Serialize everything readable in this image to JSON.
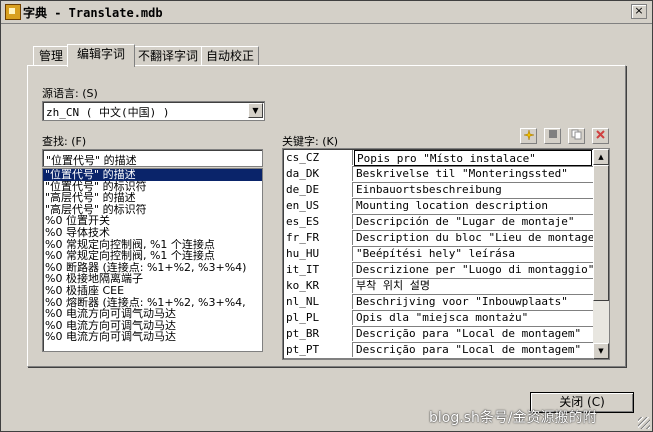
{
  "window": {
    "title": "字典 - Translate.mdb",
    "close_glyph": "×"
  },
  "tabs": [
    {
      "label": "管理"
    },
    {
      "label": "编辑字词"
    },
    {
      "label": "不翻译字词"
    },
    {
      "label": "自动校正"
    }
  ],
  "source_language": {
    "label": "源语言: (S)",
    "value": "zh_CN ( 中文(中国) )"
  },
  "search": {
    "label": "查找: (F)",
    "value": "\"位置代号\" 的描述"
  },
  "word_list": [
    "\"位置代号\" 的描述",
    "\"位置代号\" 的标识符",
    "\"高层代号\" 的描述",
    "\"高层代号\" 的标识符",
    "%0 位置开关",
    "%0 导体技术",
    "%0 常规定向控制阀, %1 个连接点",
    "%0 常规定向控制阀, %1 个连接点",
    "%0 断路器 (连接点: %1+%2, %3+%4)",
    "%0 极接地隔离端子",
    "%0 极插座 CEE",
    "%0 熔断器 (连接点: %1+%2, %3+%4,",
    "%0 电流方向可调气动马达",
    "%0 电流方向可调气动马达",
    "%0 电流方向可调气动马达"
  ],
  "keywords": {
    "label": "关键字: (K)",
    "toolbar_icons": [
      "new-entry-icon",
      "stop-icon",
      "copy-icon",
      "delete-icon"
    ],
    "rows": [
      {
        "code": "cs_CZ",
        "text": "Popis pro \"Místo instalace\""
      },
      {
        "code": "da_DK",
        "text": "Beskrivelse til \"Monteringssted\""
      },
      {
        "code": "de_DE",
        "text": "Einbauortsbeschreibung"
      },
      {
        "code": "en_US",
        "text": "Mounting location description"
      },
      {
        "code": "es_ES",
        "text": "Descripción de \"Lugar de montaje\""
      },
      {
        "code": "fr_FR",
        "text": "Description du bloc \"Lieu de montage\""
      },
      {
        "code": "hu_HU",
        "text": "\"Beépítési hely\" leírása"
      },
      {
        "code": "it_IT",
        "text": "Descrizione per \"Luogo di montaggio\""
      },
      {
        "code": "ko_KR",
        "text": "부착 위치 설명"
      },
      {
        "code": "nl_NL",
        "text": "Beschrijving voor \"Inbouwplaats\""
      },
      {
        "code": "pl_PL",
        "text": "Opis dla \"miejsca montażu\""
      },
      {
        "code": "pt_BR",
        "text": "Descrição para \"Local de montagem\""
      },
      {
        "code": "pt_PT",
        "text": "Descrição para \"Local de montagem\""
      }
    ]
  },
  "buttons": {
    "close": "关闭 (C)"
  },
  "watermark": "blog.sh条号/金资源搬的附"
}
